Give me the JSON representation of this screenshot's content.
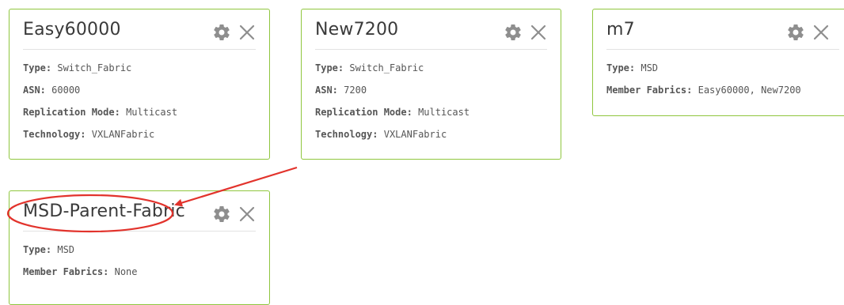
{
  "fabrics": [
    {
      "title": "Easy60000",
      "rows": [
        {
          "key": "Type:",
          "value": "Switch_Fabric"
        },
        {
          "key": "ASN:",
          "value": "60000"
        },
        {
          "key": "Replication Mode:",
          "value": "Multicast"
        },
        {
          "key": "Technology:",
          "value": "VXLANFabric"
        }
      ]
    },
    {
      "title": "New7200",
      "rows": [
        {
          "key": "Type:",
          "value": "Switch_Fabric"
        },
        {
          "key": "ASN:",
          "value": "7200"
        },
        {
          "key": "Replication Mode:",
          "value": "Multicast"
        },
        {
          "key": "Technology:",
          "value": "VXLANFabric"
        }
      ]
    },
    {
      "title": "m7",
      "rows": [
        {
          "key": "Type:",
          "value": "MSD"
        },
        {
          "key": "Member Fabrics:",
          "value": "Easy60000, New7200"
        }
      ]
    },
    {
      "title": "MSD-Parent-Fabric",
      "rows": [
        {
          "key": "Type:",
          "value": "MSD"
        },
        {
          "key": "Member Fabrics:",
          "value": "None"
        }
      ]
    }
  ],
  "icons": {
    "settings": "gear-icon",
    "close": "close-icon"
  },
  "colors": {
    "card_border": "#8fc63e",
    "annotation": "#e2332c",
    "icon": "#8e8e8e"
  }
}
